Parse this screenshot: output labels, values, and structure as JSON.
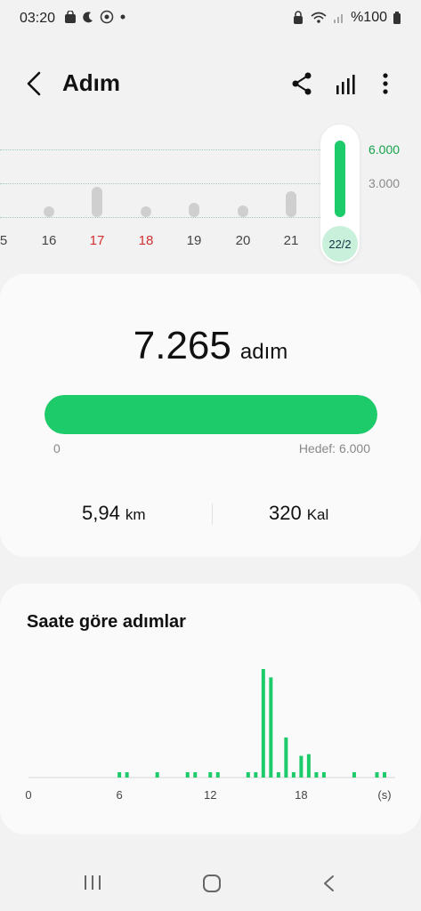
{
  "status": {
    "time": "03:20",
    "battery": "%100"
  },
  "header": {
    "title": "Adım"
  },
  "weekly_chart": {
    "y_ticks": [
      "6.000",
      "3.000"
    ],
    "days": [
      {
        "label": "5",
        "steps": null,
        "color": "normal"
      },
      {
        "label": "16",
        "steps": 400,
        "color": "normal"
      },
      {
        "label": "17",
        "steps": 2700,
        "color": "red"
      },
      {
        "label": "18",
        "steps": 400,
        "color": "red"
      },
      {
        "label": "19",
        "steps": 1300,
        "color": "normal"
      },
      {
        "label": "20",
        "steps": 1000,
        "color": "normal"
      },
      {
        "label": "21",
        "steps": 2300,
        "color": "normal"
      }
    ],
    "selected": {
      "label": "22/2",
      "steps": 7265
    }
  },
  "summary": {
    "steps_value": "7.265",
    "steps_unit": "adım",
    "progress_fraction": 1.0,
    "progress_min": "0",
    "goal_label": "Hedef: 6.000",
    "distance_value": "5,94",
    "distance_unit": "km",
    "calories_value": "320",
    "calories_unit": "Kal"
  },
  "hourly": {
    "title": "Saate göre adımlar",
    "x_tick_labels": [
      "0",
      "6",
      "12",
      "18",
      "(s)"
    ],
    "x_ticks_hours": [
      0,
      6,
      12,
      18,
      23.5
    ],
    "chart_data": {
      "type": "bar",
      "x": [
        6,
        6.5,
        8.5,
        10.5,
        11,
        12,
        12.5,
        14.5,
        15,
        15.5,
        16,
        16.5,
        17,
        17.5,
        18,
        18.5,
        19,
        19.5,
        21.5,
        23,
        23.5
      ],
      "values": [
        40,
        40,
        40,
        40,
        40,
        40,
        40,
        40,
        40,
        1300,
        1200,
        40,
        480,
        40,
        260,
        280,
        40,
        40,
        40,
        40,
        40
      ]
    }
  },
  "colors": {
    "accent": "#1ecb6b",
    "weekend": "#d32f2f",
    "bar_inactive": "#cfcfcf"
  },
  "icons": [
    "back-arrow-icon",
    "share-icon",
    "bar-chart-icon",
    "more-vert-icon",
    "recents-icon",
    "home-icon",
    "back-nav-icon"
  ]
}
